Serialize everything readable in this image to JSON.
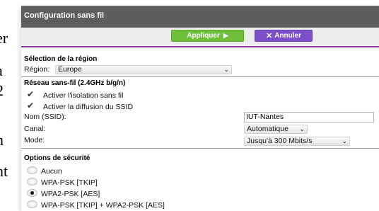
{
  "background_fragments": [
    "er",
    "a",
    "2",
    "n",
    "nt"
  ],
  "panel": {
    "title": "Configuration sans fil",
    "apply_label": "Appliquer",
    "cancel_label": "Annuler",
    "colors": {
      "apply": "#6fbf3a",
      "cancel": "#7a4fc8",
      "titlebar": "#5d5d5d",
      "accent_line": "#8a3a9e"
    }
  },
  "region": {
    "section_title": "Sélection de la région",
    "label": "Région:",
    "value": "Europe"
  },
  "wireless": {
    "section_title": "Réseau sans-fil (2.4GHz b/g/n)",
    "isolation_label": "Activer l'isolation sans fil",
    "isolation_checked": true,
    "ssid_broadcast_label": "Activer la diffusion du SSID",
    "ssid_broadcast_checked": true,
    "ssid_label": "Nom (SSID):",
    "ssid_value": "IUT-Nantes",
    "channel_label": "Canal:",
    "channel_value": "Automatique",
    "mode_label": "Mode:",
    "mode_value": "Jusqu'à 300 Mbits/s"
  },
  "security": {
    "section_title": "Options de sécurité",
    "options": [
      {
        "label": "Aucun",
        "selected": false
      },
      {
        "label": "WPA-PSK [TKIP]",
        "selected": false
      },
      {
        "label": "WPA2-PSK [AES]",
        "selected": true
      },
      {
        "label": "WPA-PSK [TKIP] + WPA2-PSK [AES]",
        "selected": false
      }
    ]
  }
}
